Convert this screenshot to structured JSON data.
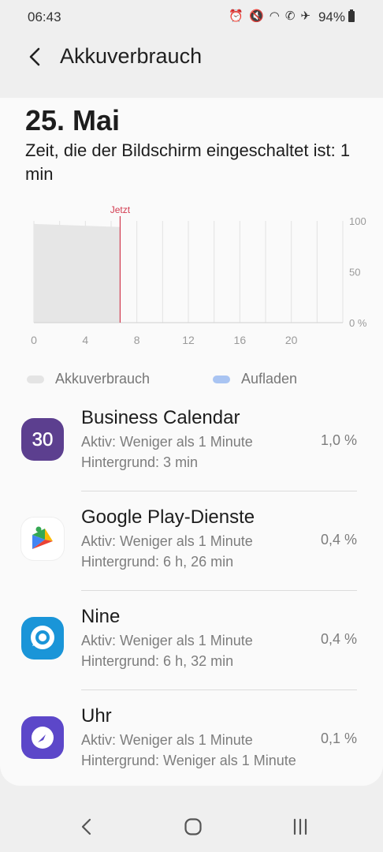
{
  "status": {
    "time": "06:43",
    "battery": "94%"
  },
  "header": {
    "title": "Akkuverbrauch"
  },
  "main": {
    "date": "25. Mai",
    "screen_on": "Zeit, die der Bildschirm eingeschaltet ist: 1 min"
  },
  "chart_data": {
    "type": "area",
    "x_ticks": [
      "0",
      "4",
      "8",
      "12",
      "16",
      "20"
    ],
    "y_ticks": [
      "100",
      "50",
      "0 %"
    ],
    "xlim": [
      0,
      24
    ],
    "ylim": [
      0,
      100
    ],
    "now_label": "Jetzt",
    "now_x": 6.7,
    "series": [
      {
        "name": "Akkuverbrauch",
        "color": "#e6e6e6",
        "x": [
          0,
          6.7
        ],
        "y": [
          97,
          94
        ]
      }
    ]
  },
  "legend": [
    {
      "label": "Akkuverbrauch",
      "color": "#e4e4e4"
    },
    {
      "label": "Aufladen",
      "color": "#a9c4f2"
    }
  ],
  "apps": [
    {
      "name": "Business Calendar",
      "active": "Aktiv: Weniger als 1 Minute",
      "background": "Hintergrund: 3 min",
      "percent": "1,0 %",
      "icon": "calendar-30-icon",
      "icon_text": "30",
      "color": "#5c3f8f"
    },
    {
      "name": "Google Play-Dienste",
      "active": "Aktiv: Weniger als 1 Minute",
      "background": "Hintergrund: 6 h, 26 min",
      "percent": "0,4 %",
      "icon": "puzzle-icon",
      "color": "#ffffff"
    },
    {
      "name": "Nine",
      "active": "Aktiv: Weniger als 1 Minute",
      "background": "Hintergrund: 6 h, 32 min",
      "percent": "0,4 %",
      "icon": "chat-bubble-icon",
      "color": "#1a95d8"
    },
    {
      "name": "Uhr",
      "active": "Aktiv: Weniger als 1 Minute",
      "background": "Hintergrund: Weniger als 1 Minute",
      "percent": "0,1 %",
      "icon": "clock-icon",
      "color": "#5c47c9"
    }
  ]
}
